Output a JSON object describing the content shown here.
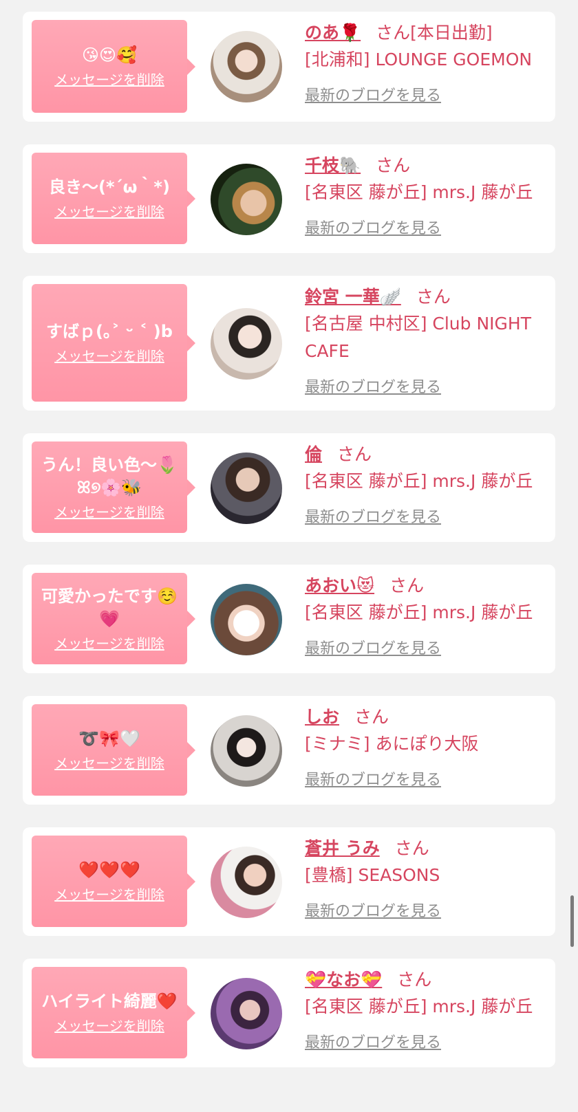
{
  "colors": {
    "background": "#f2f2f2",
    "card": "#ffffff",
    "bubble": "#ff9dac",
    "accent": "#d6455f",
    "link_gray": "#8e8e8e"
  },
  "cards": [
    {
      "message": "😘😍🥰",
      "delete_label": "メッセージを削除",
      "name": "のあ🌹",
      "honorific": "さん",
      "status": "[本日出勤]",
      "shop": "[北浦和] LOUNGE GOEMON",
      "blog_label": "最新のブログを見る"
    },
    {
      "message": "良き〜(*´ω｀*)",
      "delete_label": "メッセージを削除",
      "name": "千枝🐘",
      "honorific": "さん",
      "status": "",
      "shop": "[名東区 藤が丘] mrs.J 藤が丘",
      "blog_label": "最新のブログを見る"
    },
    {
      "message": "すばｐ(｡˃ ᵕ ˂ )b",
      "delete_label": "メッセージを削除",
      "name": "鈴宮 一華🪽",
      "honorific": "さん",
      "status": "",
      "shop": "[名古屋 中村区] Club NIGHT CAFE",
      "blog_label": "最新のブログを見る"
    },
    {
      "message": "うん！良い色〜🌷ꕤ୭🌸🐝",
      "delete_label": "メッセージを削除",
      "name": "倫",
      "honorific": "さん",
      "status": "",
      "shop": "[名東区 藤が丘] mrs.J 藤が丘",
      "blog_label": "最新のブログを見る"
    },
    {
      "message": "可愛かったです☺️💗",
      "delete_label": "メッセージを削除",
      "name": "あおい😻",
      "honorific": "さん",
      "status": "",
      "shop": "[名東区 藤が丘] mrs.J 藤が丘",
      "blog_label": "最新のブログを見る"
    },
    {
      "message": "➰🎀🤍",
      "delete_label": "メッセージを削除",
      "name": "しお",
      "honorific": "さん",
      "status": "",
      "shop": "[ミナミ] あにぽり大阪",
      "blog_label": "最新のブログを見る"
    },
    {
      "message": "❤️❤️❤️",
      "delete_label": "メッセージを削除",
      "name": "蒼井 うみ",
      "honorific": "さん",
      "status": "",
      "shop": "[豊橋] SEASONS",
      "blog_label": "最新のブログを見る"
    },
    {
      "message": "ハイライト綺麗❤️",
      "delete_label": "メッセージを削除",
      "name": "💝なお💝",
      "honorific": "さん",
      "status": "",
      "shop": "[名東区 藤が丘] mrs.J 藤が丘",
      "blog_label": "最新のブログを見る"
    }
  ]
}
